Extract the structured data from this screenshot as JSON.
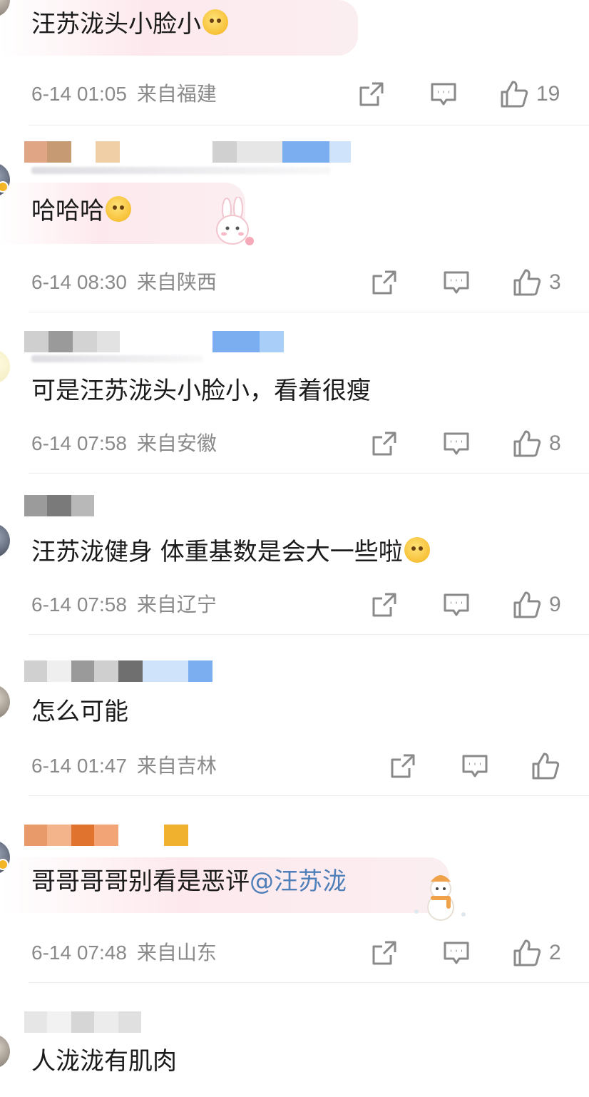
{
  "comments": [
    {
      "text": "汪苏泷头小脸小",
      "emoji": "crying-emoji",
      "date": "6-14 01:05",
      "location": "来自福建",
      "likes": "19"
    },
    {
      "text": "哈哈哈",
      "emoji": "thinking-emoji",
      "date": "6-14 08:30",
      "location": "来自陕西",
      "likes": "3",
      "sticker": "bunny-sticker"
    },
    {
      "text": "可是汪苏泷头小脸小，看着很瘦",
      "date": "6-14 07:58",
      "location": "来自安徽",
      "likes": "8"
    },
    {
      "text": "汪苏泷健身 体重基数是会大一些啦",
      "emoji": "pleading-emoji",
      "date": "6-14 07:58",
      "location": "来自辽宁",
      "likes": "9"
    },
    {
      "text": "怎么可能",
      "date": "6-14 01:47",
      "location": "来自吉林",
      "likes": ""
    },
    {
      "text": "哥哥哥哥别看是恶评",
      "mention": "@汪苏泷",
      "date": "6-14 07:48",
      "location": "来自山东",
      "likes": "2",
      "sticker": "snowman-sticker"
    },
    {
      "text": "人泷泷有肌肉"
    }
  ],
  "icons": {
    "share": "share-icon",
    "comment": "comment-icon",
    "like": "thumbs-up-icon"
  },
  "colors": {
    "mention": "#4f7fb8",
    "meta": "#8a8a8a"
  }
}
